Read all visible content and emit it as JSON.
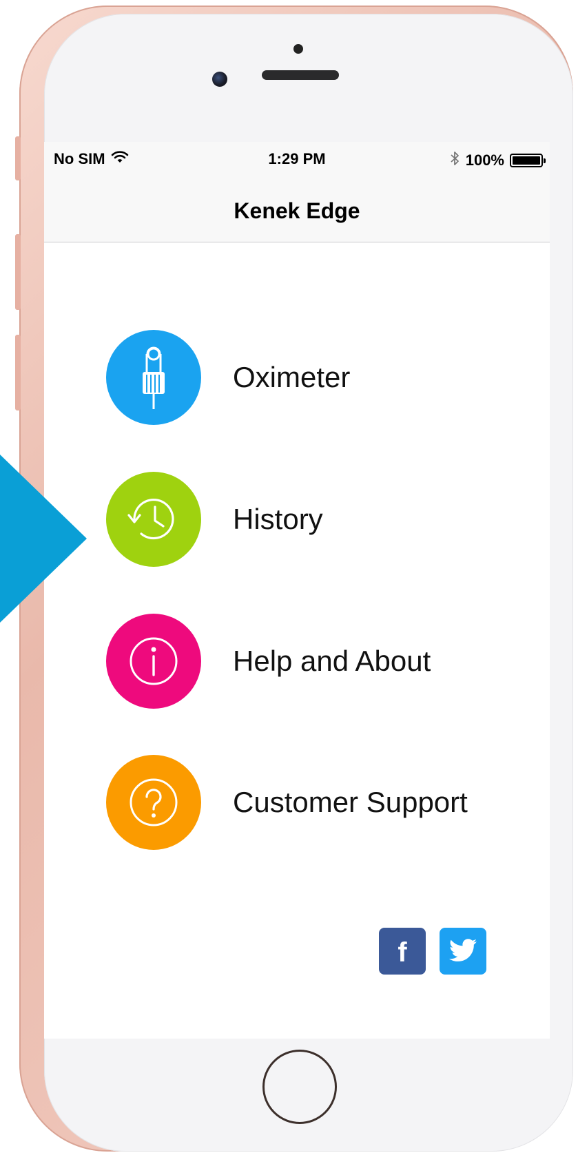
{
  "status_bar": {
    "carrier": "No SIM",
    "time": "1:29 PM",
    "battery_percent": "100%",
    "battery_level": 1.0,
    "icons": [
      "wifi-icon",
      "bluetooth-icon",
      "battery-icon"
    ]
  },
  "nav": {
    "title": "Kenek Edge"
  },
  "menu": [
    {
      "label": "Oximeter",
      "icon": "oximeter-sensor-icon",
      "color": "#1aa3f0"
    },
    {
      "label": "History",
      "icon": "history-clock-icon",
      "color": "#9fd20f"
    },
    {
      "label": "Help and About",
      "icon": "info-icon",
      "color": "#ee0a7d"
    },
    {
      "label": "Customer Support",
      "icon": "question-icon",
      "color": "#fb9b00"
    }
  ],
  "social": [
    {
      "icon": "facebook-icon",
      "glyph": "f",
      "color": "#3b5998"
    },
    {
      "icon": "twitter-icon",
      "color": "#1da1f2"
    }
  ],
  "colors": {
    "phone_frame": "#e9b9ab",
    "pointer_arrow": "#0a9fd6"
  }
}
